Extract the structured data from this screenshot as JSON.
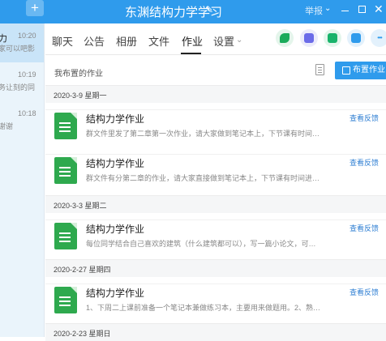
{
  "titlebar": {
    "add_glyph": "+",
    "title": "东渊结构力学学习",
    "edit_glyph": "✎",
    "report": "举报",
    "caret": "⌄",
    "close": "✕"
  },
  "conversations": [
    {
      "name": "力",
      "time": "10:20",
      "preview": "家可以吧影"
    },
    {
      "name": "",
      "time": "10:19",
      "preview": "务让刻的同"
    },
    {
      "name": "",
      "time": "10:18",
      "preview": "谢谢"
    }
  ],
  "tabs": [
    "聊天",
    "公告",
    "相册",
    "文件",
    "作业",
    "设置"
  ],
  "active_tab": "作业",
  "settings_caret": "⌄",
  "toolbar": {
    "more_glyph": "•••",
    "colors": {
      "phone": "#1aab5a",
      "video": "#6b6be8",
      "file": "#19b36b",
      "add": "#2f9bec",
      "more": "#2f9bec"
    }
  },
  "homework": {
    "section_label": "我布置的作业",
    "assign_button": "布置作业"
  },
  "groups": [
    {
      "date": "2020-3-9 星期一",
      "items": [
        {
          "title": "结构力学作业",
          "desc": "群文件里发了第二章第一次作业，请大家做到笔记本上，下节课有时间进行讨...",
          "link": "查看反馈"
        },
        {
          "title": "结构力学作业",
          "desc": "群文件有分第二章的作业，请大家直接做到笔记本上，下节课有时间进行讨论...",
          "link": "查看反馈"
        }
      ]
    },
    {
      "date": "2020-3-3 星期二",
      "items": [
        {
          "title": "结构力学作业",
          "desc": "每位同学结合自己喜欢的建筑（什么建筑都可以），写一篇小论文，可以有图...",
          "link": "查看反馈"
        }
      ]
    },
    {
      "date": "2020-2-27 星期四",
      "items": [
        {
          "title": "结构力学作业",
          "desc": "1、下周二上课前准备一个笔记本兼做练习本，主要用来做题用。2、熟悉腾讯...",
          "link": "查看反馈"
        }
      ]
    },
    {
      "date": "2020-2-23 星期日",
      "items": []
    }
  ]
}
